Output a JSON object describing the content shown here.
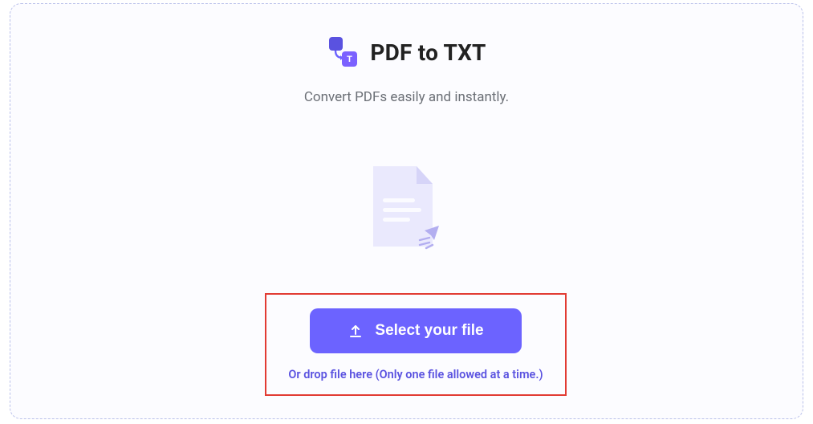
{
  "header": {
    "title": "PDF to TXT",
    "subtitle": "Convert PDFs easily and instantly."
  },
  "action": {
    "button_label": "Select your file",
    "drop_hint": "Or drop file here (Only one file allowed at a time.)"
  }
}
